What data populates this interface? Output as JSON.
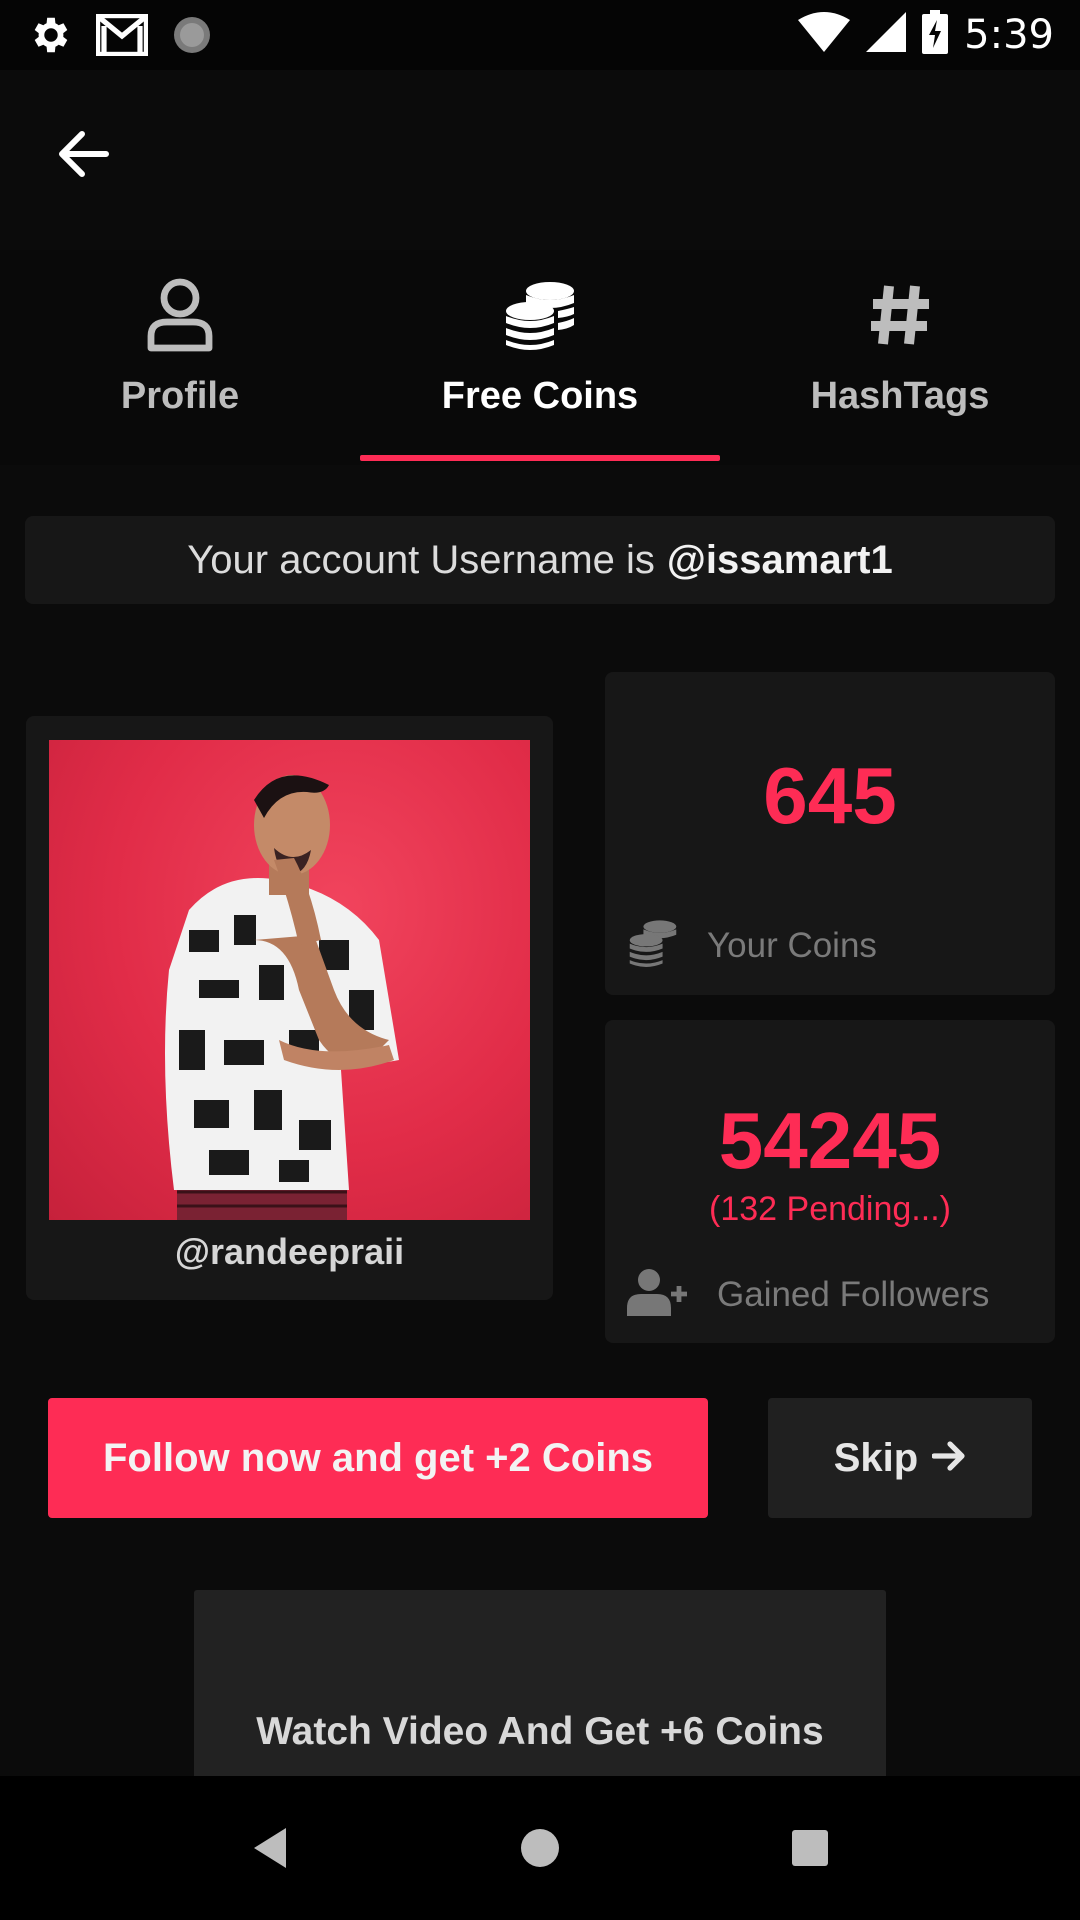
{
  "status_bar": {
    "time": "5:39",
    "icons_left": [
      "gear-icon",
      "gmail-icon",
      "loading-icon"
    ],
    "icons_right": [
      "wifi-icon",
      "signal-icon",
      "battery-charging-icon"
    ]
  },
  "header": {
    "back_icon": "arrow-left-icon"
  },
  "tabs": [
    {
      "label": "Profile",
      "icon": "person-icon",
      "active": false
    },
    {
      "label": "Free Coins",
      "icon": "coins-icon",
      "active": true
    },
    {
      "label": "HashTags",
      "icon": "hash-icon",
      "active": false
    }
  ],
  "account": {
    "prefix": "Your account Username is",
    "username": "@issamart1"
  },
  "target": {
    "handle": "@randeepraii"
  },
  "stats": {
    "coins": {
      "value": "645",
      "label": "Your Coins"
    },
    "followers": {
      "value": "54245",
      "pending": "(132 Pending...)",
      "label": "Gained Followers"
    }
  },
  "actions": {
    "follow_label": "Follow now and get +2 Coins",
    "skip_label": "Skip",
    "watch_label": "Watch Video And Get +6 Coins"
  },
  "colors": {
    "accent": "#fe2c55",
    "background": "#0b0b0b",
    "card": "#171717"
  }
}
